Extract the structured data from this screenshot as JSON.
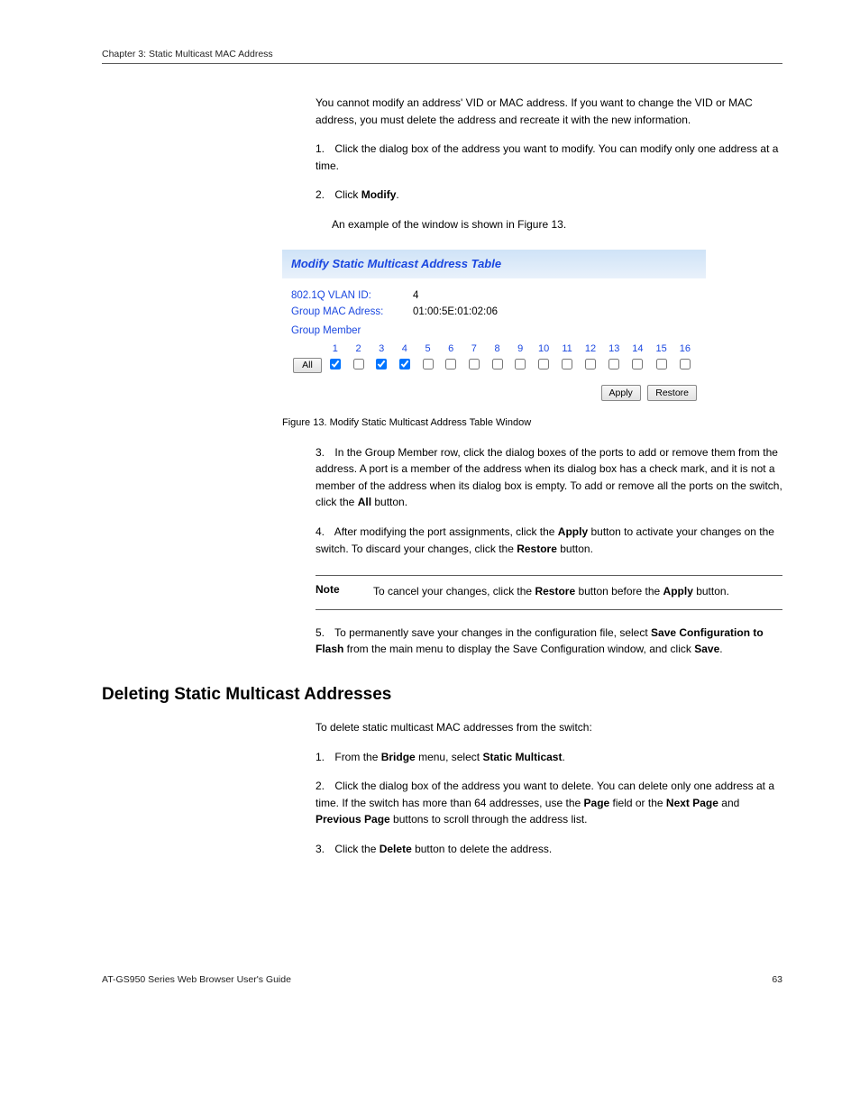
{
  "running_header": "Chapter 3: Static Multicast MAC Address",
  "prose": {
    "intro": "You cannot modify an address' VID or MAC address. If you want to change the VID or MAC address, you must delete the address and recreate it with the new information.",
    "step1_num": "1.",
    "step1": "Click the dialog box of the address you want to modify. You can modify only one address at a time.",
    "step2_num": "2.",
    "step2": "Click ",
    "step2_btn": "Modify",
    "step2_after": ".",
    "step3_lead": "An example of the window is shown in ",
    "step3_figref": "Figure 13"
  },
  "figure": {
    "title": "Modify Static Multicast Address Table",
    "vlan_label": "802.1Q VLAN ID:",
    "vlan_value": "4",
    "mac_label": "Group MAC Adress:",
    "mac_value": "01:00:5E:01:02:06",
    "group_label": "Group Member",
    "all_btn": "All",
    "ports": [
      "1",
      "2",
      "3",
      "4",
      "5",
      "6",
      "7",
      "8",
      "9",
      "10",
      "11",
      "12",
      "13",
      "14",
      "15",
      "16"
    ],
    "checked": [
      true,
      false,
      true,
      true,
      false,
      false,
      false,
      false,
      false,
      false,
      false,
      false,
      false,
      false,
      false,
      false
    ],
    "apply_btn": "Apply",
    "restore_btn": "Restore"
  },
  "caption": "Figure 13. Modify Static Multicast Address Table Window",
  "step3": {
    "num": "3.",
    "text_a": "In the Group Member row, click the dialog boxes of the ports to add or remove them from the address. A port is a member of the address when its dialog box has a check mark, and it is not a member of the address when its dialog box is empty. To add or remove all the ports on the switch, click the ",
    "btn": "All",
    "text_b": " button."
  },
  "step4": {
    "num": "4.",
    "text_a": "After modifying the port assignments, click the ",
    "btn": "Apply",
    "text_b": " button to activate your changes on the switch. To discard your changes, click the ",
    "btn2": "Restore",
    "text_c": " button."
  },
  "step5": {
    "num": "5.",
    "text": "To permanently save your changes in the configuration file, select ",
    "bold": "Save Configuration to Flash",
    "after": " from the main menu to display the Save Configuration window, and click ",
    "btn": "Save",
    "period": "."
  },
  "note": {
    "label": "Note",
    "text_a": "To cancel your changes, click the ",
    "btn": "Restore",
    "text_b": " button before the ",
    "btn2": "Apply",
    "text_c": " button."
  },
  "h2": "Deleting Static Multicast Addresses",
  "del_intro": "To delete static multicast MAC addresses from the switch:",
  "del_step1": {
    "num": "1.",
    "text_a": "From the ",
    "b1": "Bridge",
    "text_b": " menu, select ",
    "b2": "Static Multicast",
    "period": "."
  },
  "del_step2": {
    "num": "2.",
    "text_a": "Click the dialog box of the address you want to delete. You can delete only one address at a time. If the switch has more than ",
    "b1": "64",
    "text_b": " addresses, use the ",
    "btn1": "Page",
    "text_c": " field or the ",
    "btn2": "Next Page",
    "text_d": " and ",
    "btn3": "Previous Page",
    "text_e": " buttons to scroll through the address list."
  },
  "del_step3": {
    "num": "3.",
    "text_a": "Click the ",
    "btn": "Delete",
    "text_b": " button to delete the address."
  },
  "footer": {
    "left": "AT-GS950 Series Web Browser User's Guide",
    "right": "63"
  }
}
